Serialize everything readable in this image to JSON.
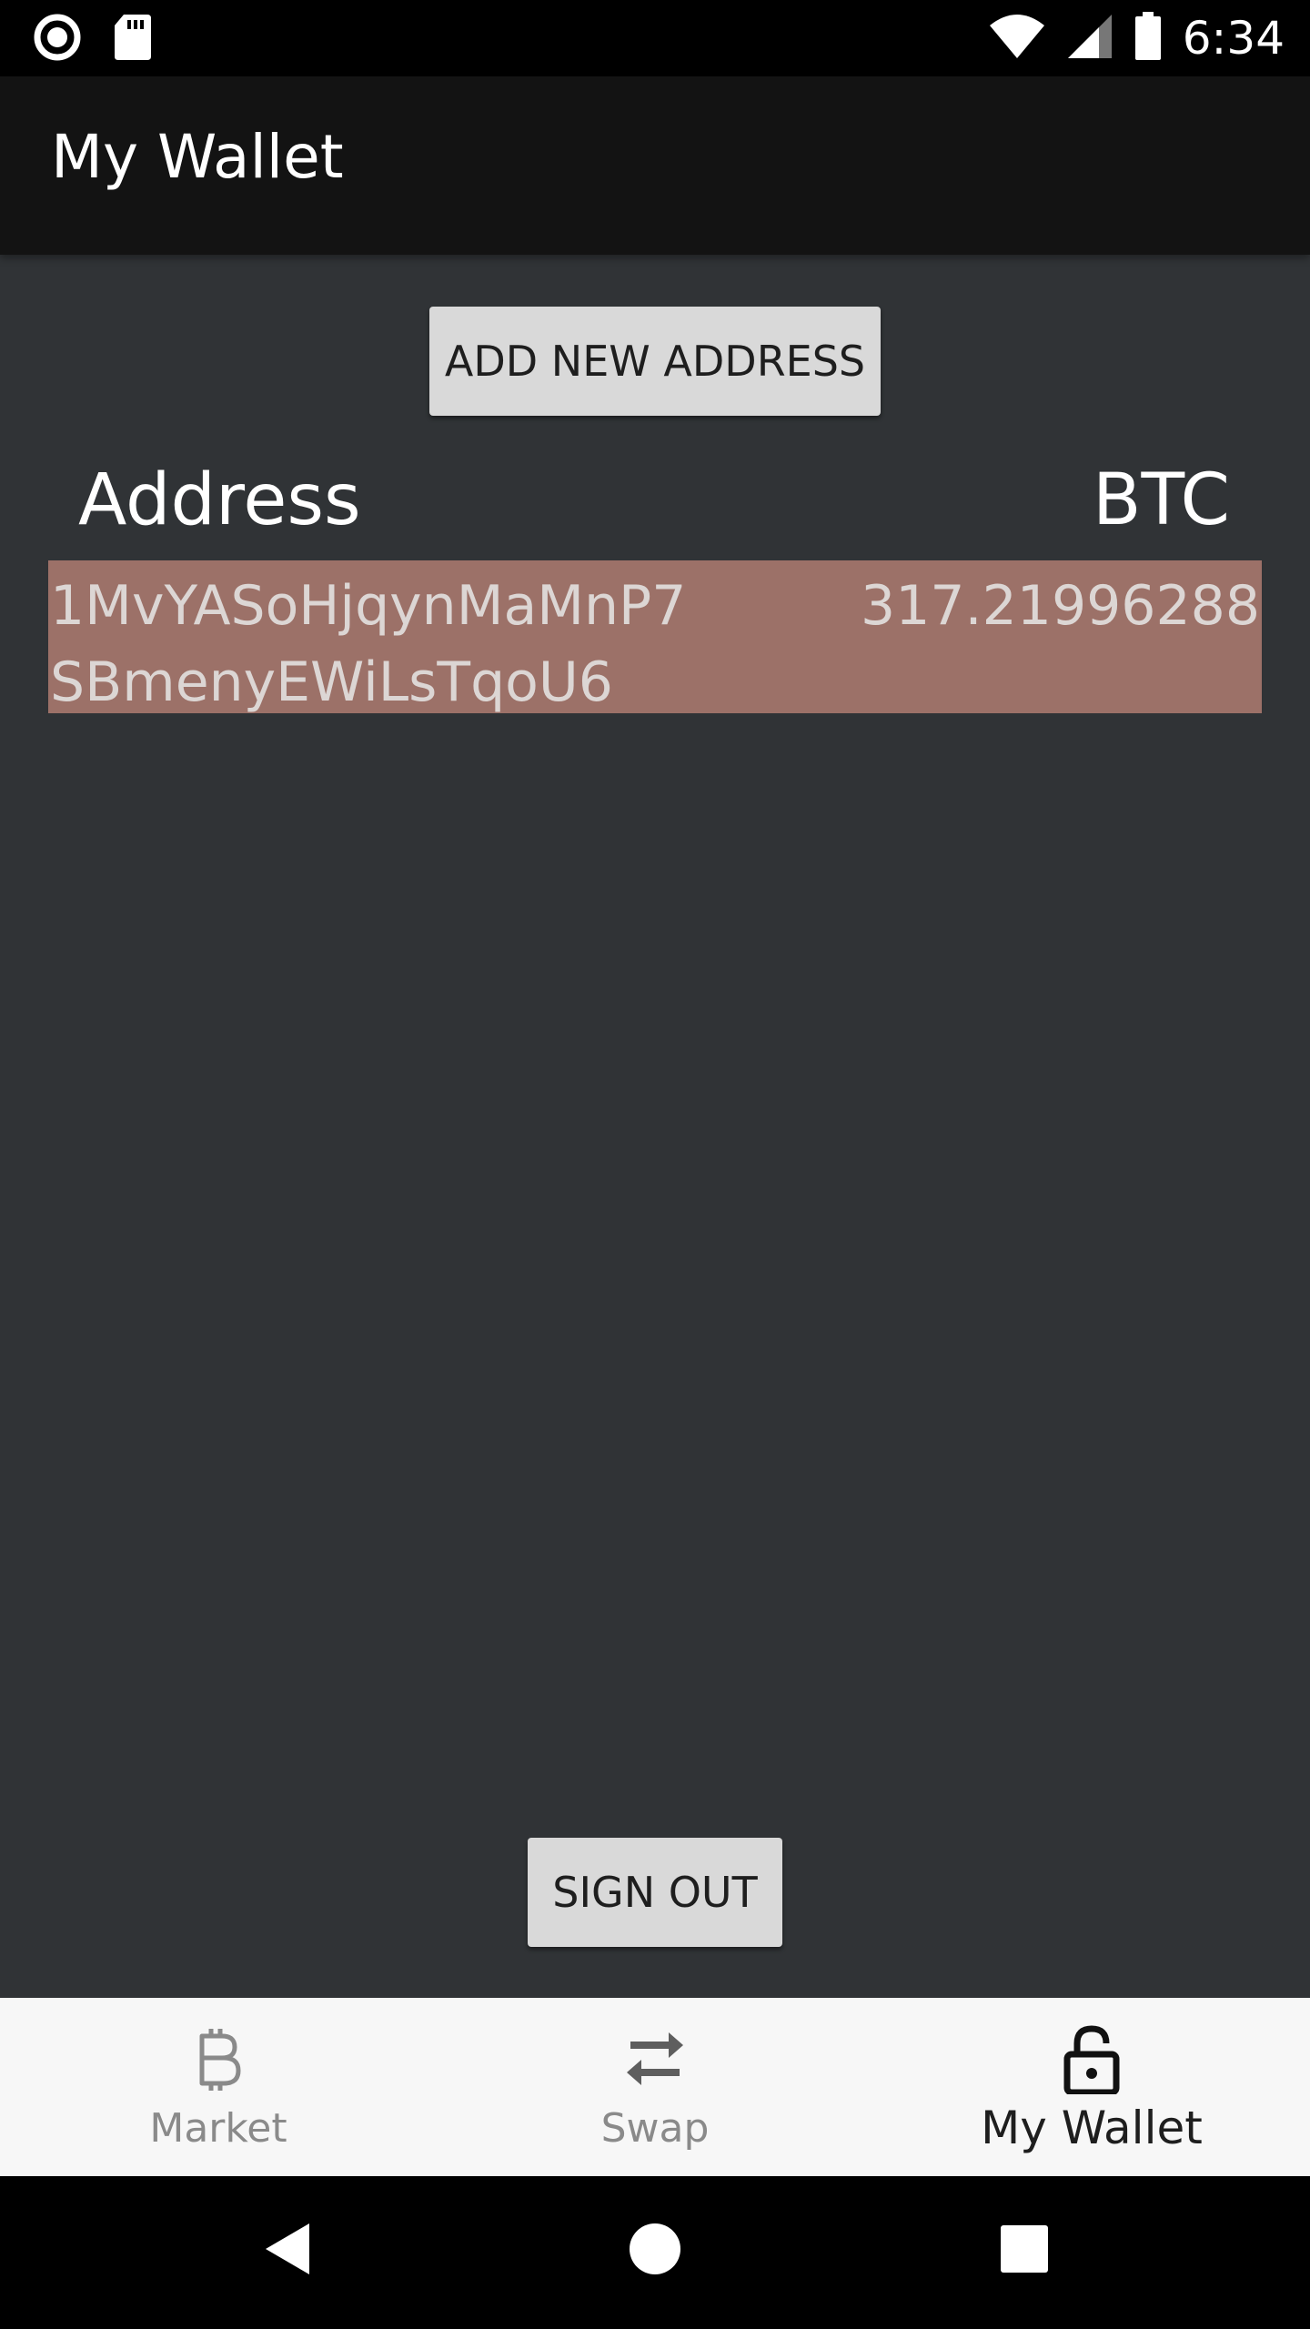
{
  "status_bar": {
    "time": "6:34"
  },
  "app_bar": {
    "title": "My Wallet"
  },
  "actions": {
    "add_address_label": "ADD NEW ADDRESS",
    "sign_out_label": "SIGN OUT"
  },
  "table": {
    "headers": {
      "address": "Address",
      "balance": "BTC"
    },
    "rows": [
      {
        "address": "1MvYASoHjqynMaMnP7SBmenyEWiLsTqoU6",
        "balance": "317.21996288"
      }
    ]
  },
  "bottom_nav": {
    "items": [
      {
        "label": "Market",
        "icon": "bitcoin-icon",
        "active": false
      },
      {
        "label": "Swap",
        "icon": "swap-arrows-icon",
        "active": false
      },
      {
        "label": "My Wallet",
        "icon": "lock-open-icon",
        "active": true
      }
    ]
  },
  "colors": {
    "background": "#303336",
    "app_bar": "#131313",
    "row_highlight": "#9c7168",
    "button": "#d9d9d9",
    "nav_bar": "#f7f7f7"
  }
}
